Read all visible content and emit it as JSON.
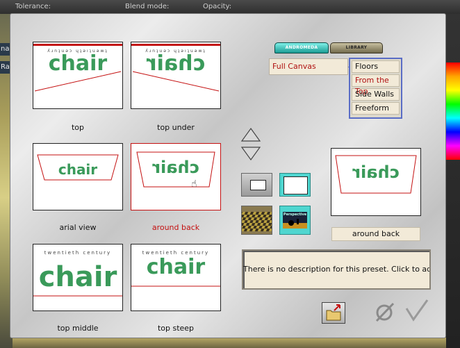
{
  "host": {
    "top_labels": [
      "Tolerance:",
      "Blend mode:",
      "Opacity:"
    ],
    "left_tabs": [
      "na",
      "Ras"
    ]
  },
  "tabs": {
    "andromeda": "ANDROMEDA",
    "library": "LIBRARY"
  },
  "category": {
    "selected": "Full Canvas"
  },
  "subcategories": [
    {
      "label": "Floors",
      "active": false
    },
    {
      "label": "From the Top",
      "active": true
    },
    {
      "label": "Side Walls",
      "active": false
    },
    {
      "label": "Freeform",
      "active": false
    }
  ],
  "presets": [
    {
      "name": "top",
      "selected": false
    },
    {
      "name": "top under",
      "selected": false
    },
    {
      "name": "arial view",
      "selected": false
    },
    {
      "name": "around back",
      "selected": true
    },
    {
      "name": "top middle",
      "selected": false
    },
    {
      "name": "top steep",
      "selected": false
    }
  ],
  "thumb_text": {
    "word": "chair",
    "banner": "twentieth century",
    "banner_mirrored": "ʎɹnʇuǝɔ ɥʇǝıʇuǝʍʇ"
  },
  "preview": {
    "name": "around back"
  },
  "perspective_button_label": "Perspective",
  "description": "There is no description for this preset. Click to add one",
  "colors": {
    "selected_text": "#c41010",
    "chair_green": "#3a9a5a",
    "list_border": "#5a6dc6",
    "accent_cyan": "#4fd6d0"
  }
}
